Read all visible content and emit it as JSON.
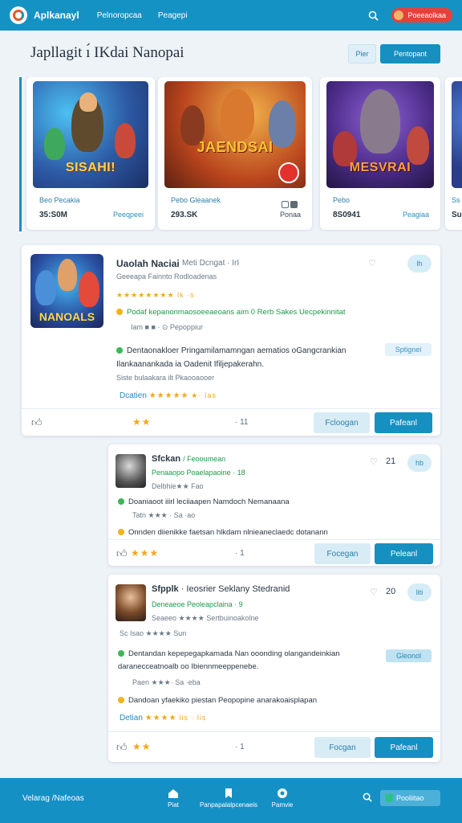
{
  "topbar": {
    "brand": "Aplkanayl",
    "nav": [
      "Pelnoropcaa",
      "Peagepi"
    ],
    "profile": "Poeeaolkaa"
  },
  "page": {
    "title": "Japllagit ı́ IKdai Nanopai",
    "btn_ghost": "Pier",
    "btn_solid": "Pentopant"
  },
  "games": [
    {
      "art_title": "SISAHI!",
      "title": "Beo Pecakia",
      "count": "35:S0M",
      "link": "Peeqpeei"
    },
    {
      "art_title": "JAENDSAI",
      "title": "Pebo Gleaanek",
      "count": "293.SK",
      "link": "Ponaa"
    },
    {
      "art_title": "MESVRAI",
      "title": "Pebo",
      "count": "8S0941",
      "link": "Peagiaa"
    },
    {
      "art_title": "",
      "title": "Ss",
      "count": "Su",
      "link": ""
    }
  ],
  "reviews": [
    {
      "thumb_title": "NANOALS",
      "name": "Uaolah Naciai",
      "sub_name": "Meti Dcngat · IrI",
      "meta": "Geeeapa Fainnto  Rodloadenas",
      "rating_text": "★★★★★★★★ lk ·s",
      "highlight": "Podaf kepanonmaosoeeaeoans aim 0 Rerb Sakes Uecpekinnitat",
      "tags_line": "Iam ■ ■ · ⊙ Pepoppiur",
      "body": "Dentaonakloer Pringamilamamngan aematios oGangcrankian Ilankaanankada ia Oadenit Ifiljepakerahn.",
      "body_tag": "Sptignei",
      "stat_line": "Siste bulaakara ilt Pkaooaooer",
      "rating_line_label": "Dcatien",
      "rating_line_stars": "★★★★★",
      "rating_line_extra": "★· Ias",
      "heart": "♡",
      "heart_count": "",
      "pill": "lh",
      "actions": {
        "stars": "★★",
        "count": "· 11",
        "btn_light": "Fcloogan",
        "btn_blue": "Pafeanl"
      }
    },
    {
      "name": "Sfckan",
      "sub_name": "/ Feooumean",
      "meta": "Penaaopo Poaelapaoine · 18",
      "rating_text": "Delbhie★★ Fao",
      "highlight": "Doaniaoot iiirl leciiaapen Namdoch Nemanaana",
      "tags_line": "Tatn ★★★ · Sa ·ao",
      "body": "Onnden diienikke faetsan hlkdam nlnieaneclaedc dotanann",
      "body_tag": "",
      "heart": "♡",
      "heart_count": "21",
      "pill": "hb",
      "actions": {
        "stars": "★★★",
        "count": "· 1",
        "btn_light": "Focegan",
        "btn_blue": "Peleanl"
      }
    },
    {
      "name": "Sfpplk",
      "sub_name": "· Ieosrier Seklany Stedranid",
      "meta": "Deneaeoe Peoleapclaina · 9",
      "rating_text": "Seaeeo ★★★★ Sertbuinoakolne",
      "stat_line": "Sc Isao ★★★★ Sun",
      "body": "Dentandan kepepegapkamada Nan ooonding olangandeinkian daranecceatnoalb oo Ibiennmeeppenebe.",
      "body_tag": "Gleonol",
      "tags_line": "Paen ★★★· Sa ·eba",
      "highlight": "Dandoan yfaekiko piestan Peopopine anarakoaisplapan",
      "rating_line_label": "Detian",
      "rating_line_stars": "★★★★",
      "rating_line_extra": "lis · lis",
      "heart": "♡",
      "heart_count": "20",
      "pill": "liti",
      "actions": {
        "stars": "★★",
        "count": "· 1",
        "btn_light": "Focgan",
        "btn_blue": "Pafeanl"
      }
    }
  ],
  "bottombar": {
    "brand": "Velarag /Nafeoas",
    "items": [
      {
        "label": "Piat",
        "icon": "home-icon"
      },
      {
        "label": "Panpapalalpcenaeis",
        "icon": "bookmark-icon"
      },
      {
        "label": "Pamvie",
        "icon": "globe-icon"
      }
    ],
    "chip": "Pooliitao"
  },
  "colors": {
    "primary": "#1592c4",
    "accent_red": "#e5413a",
    "star": "#f2a81c",
    "green": "#1b9a4a"
  }
}
